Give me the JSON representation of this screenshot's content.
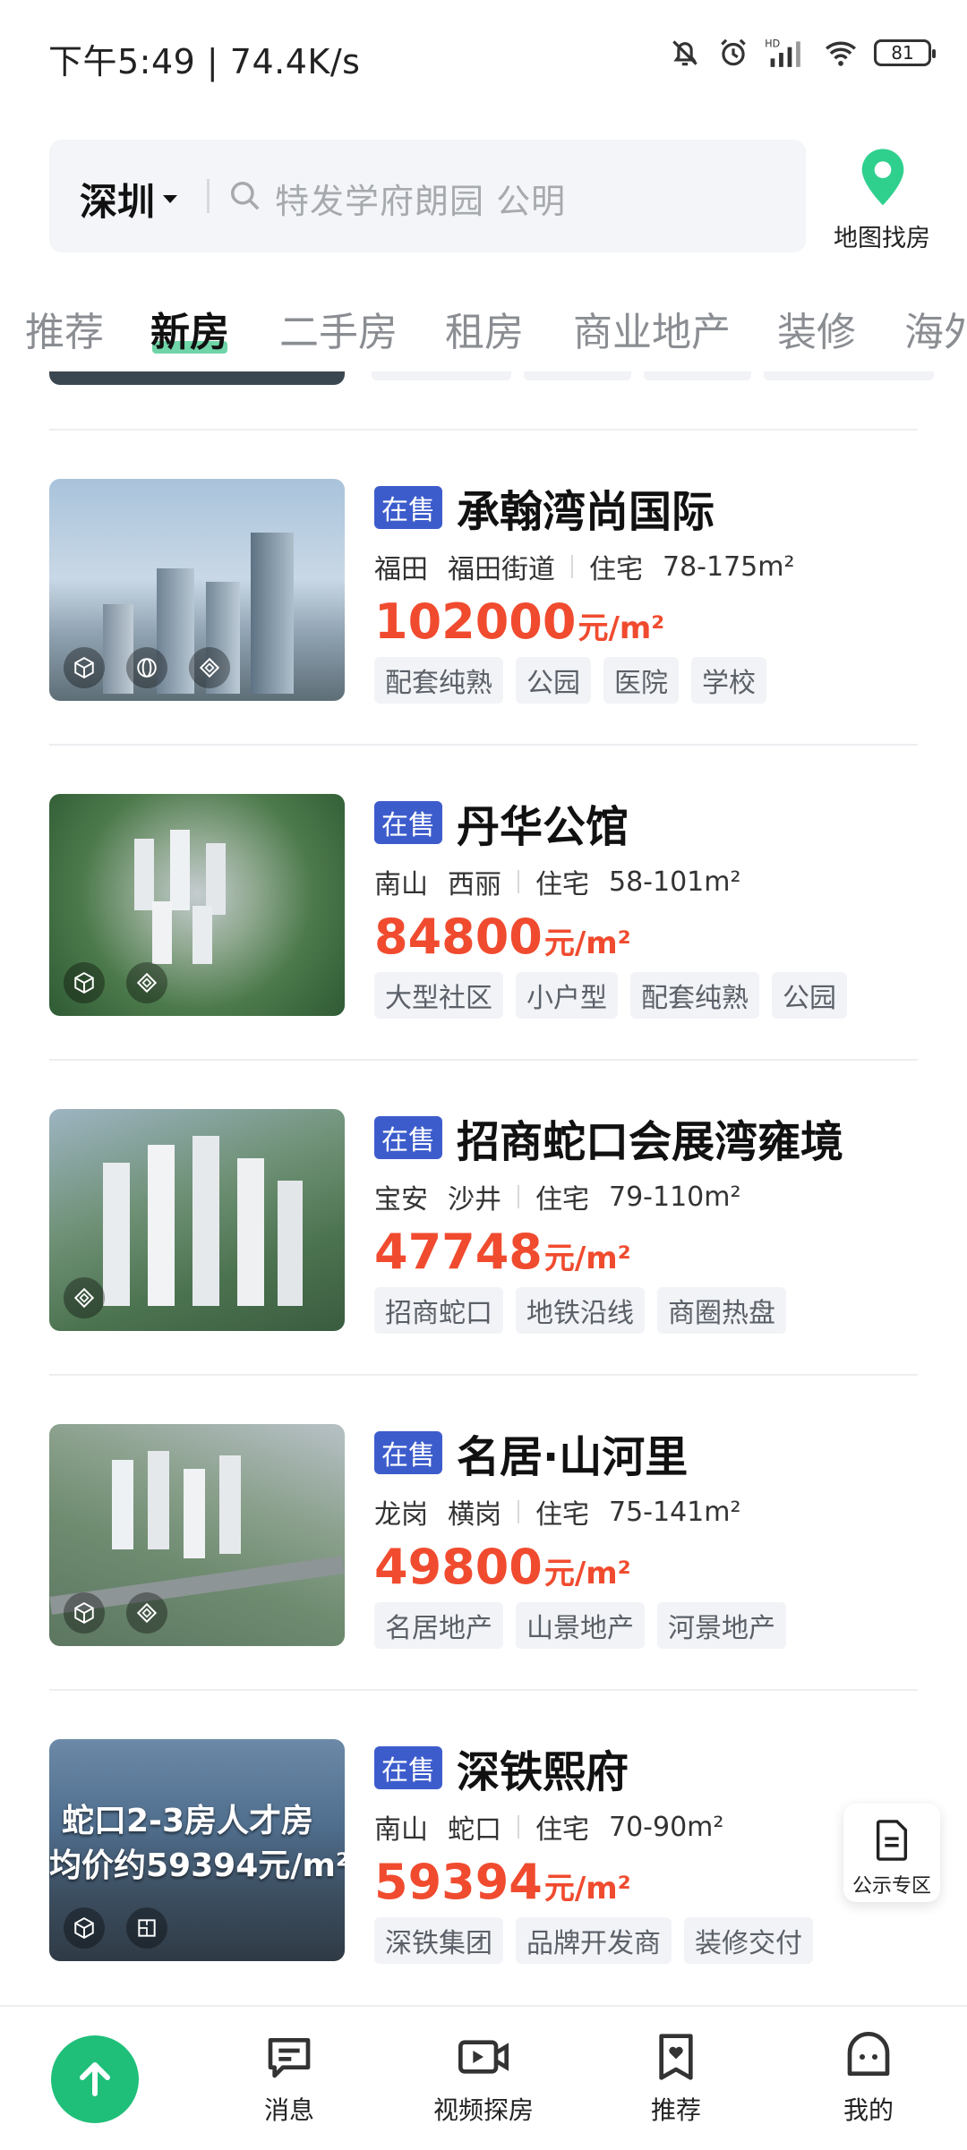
{
  "status_bar": {
    "time": "下午5:49 | 74.4K/s",
    "battery": "81",
    "network": "HD"
  },
  "search": {
    "city": "深圳",
    "placeholder": "特发学府朗园 公明"
  },
  "map_find": {
    "label": "地图找房"
  },
  "tabs": [
    {
      "label": "推荐",
      "active": false
    },
    {
      "label": "新房",
      "active": true
    },
    {
      "label": "二手房",
      "active": false
    },
    {
      "label": "租房",
      "active": false
    },
    {
      "label": "商业地产",
      "active": false
    },
    {
      "label": "装修",
      "active": false
    },
    {
      "label": "海外",
      "active": false
    }
  ],
  "listings": [
    {
      "status": "在售",
      "name": "承翰湾尚国际",
      "district": "福田",
      "area": "福田街道",
      "type": "住宅",
      "size": "78-175m²",
      "price": "102000",
      "unit": "元/m²",
      "tags": [
        "配套纯熟",
        "公园",
        "医院",
        "学校"
      ],
      "thumb_icons": [
        "cube-icon",
        "panorama-icon",
        "vr-icon"
      ]
    },
    {
      "status": "在售",
      "name": "丹华公馆",
      "district": "南山",
      "area": "西丽",
      "type": "住宅",
      "size": "58-101m²",
      "price": "84800",
      "unit": "元/m²",
      "tags": [
        "大型社区",
        "小户型",
        "配套纯熟",
        "公园"
      ],
      "thumb_icons": [
        "cube-icon",
        "vr-icon"
      ]
    },
    {
      "status": "在售",
      "name": "招商蛇口会展湾雍境",
      "district": "宝安",
      "area": "沙井",
      "type": "住宅",
      "size": "79-110m²",
      "price": "47748",
      "unit": "元/m²",
      "tags": [
        "招商蛇口",
        "地铁沿线",
        "商圈热盘"
      ],
      "thumb_icons": [
        "vr-icon"
      ]
    },
    {
      "status": "在售",
      "name": "名居·山河里",
      "district": "龙岗",
      "area": "横岗",
      "type": "住宅",
      "size": "75-141m²",
      "price": "49800",
      "unit": "元/m²",
      "tags": [
        "名居地产",
        "山景地产",
        "河景地产"
      ],
      "thumb_icons": [
        "cube-icon",
        "vr-icon"
      ]
    },
    {
      "status": "在售",
      "name": "深铁熙府",
      "district": "南山",
      "area": "蛇口",
      "type": "住宅",
      "size": "70-90m²",
      "price": "59394",
      "unit": "元/m²",
      "tags": [
        "深铁集团",
        "品牌开发商",
        "装修交付"
      ],
      "thumb_icons": [
        "cube-icon",
        "floorplan-icon"
      ],
      "overlay_lines": [
        "蛇口2-3房人才房",
        "均价约59394元/m²"
      ]
    }
  ],
  "notice": {
    "label": "公示专区"
  },
  "bottom_nav": [
    {
      "label": "消息",
      "icon": "message-icon"
    },
    {
      "label": "视频探房",
      "icon": "video-icon"
    },
    {
      "label": "推荐",
      "icon": "recommend-icon"
    },
    {
      "label": "我的",
      "icon": "profile-icon"
    }
  ],
  "colors": {
    "accent": "#1fbf7a",
    "price": "#f04b2f",
    "badge": "#3d5ccc"
  }
}
